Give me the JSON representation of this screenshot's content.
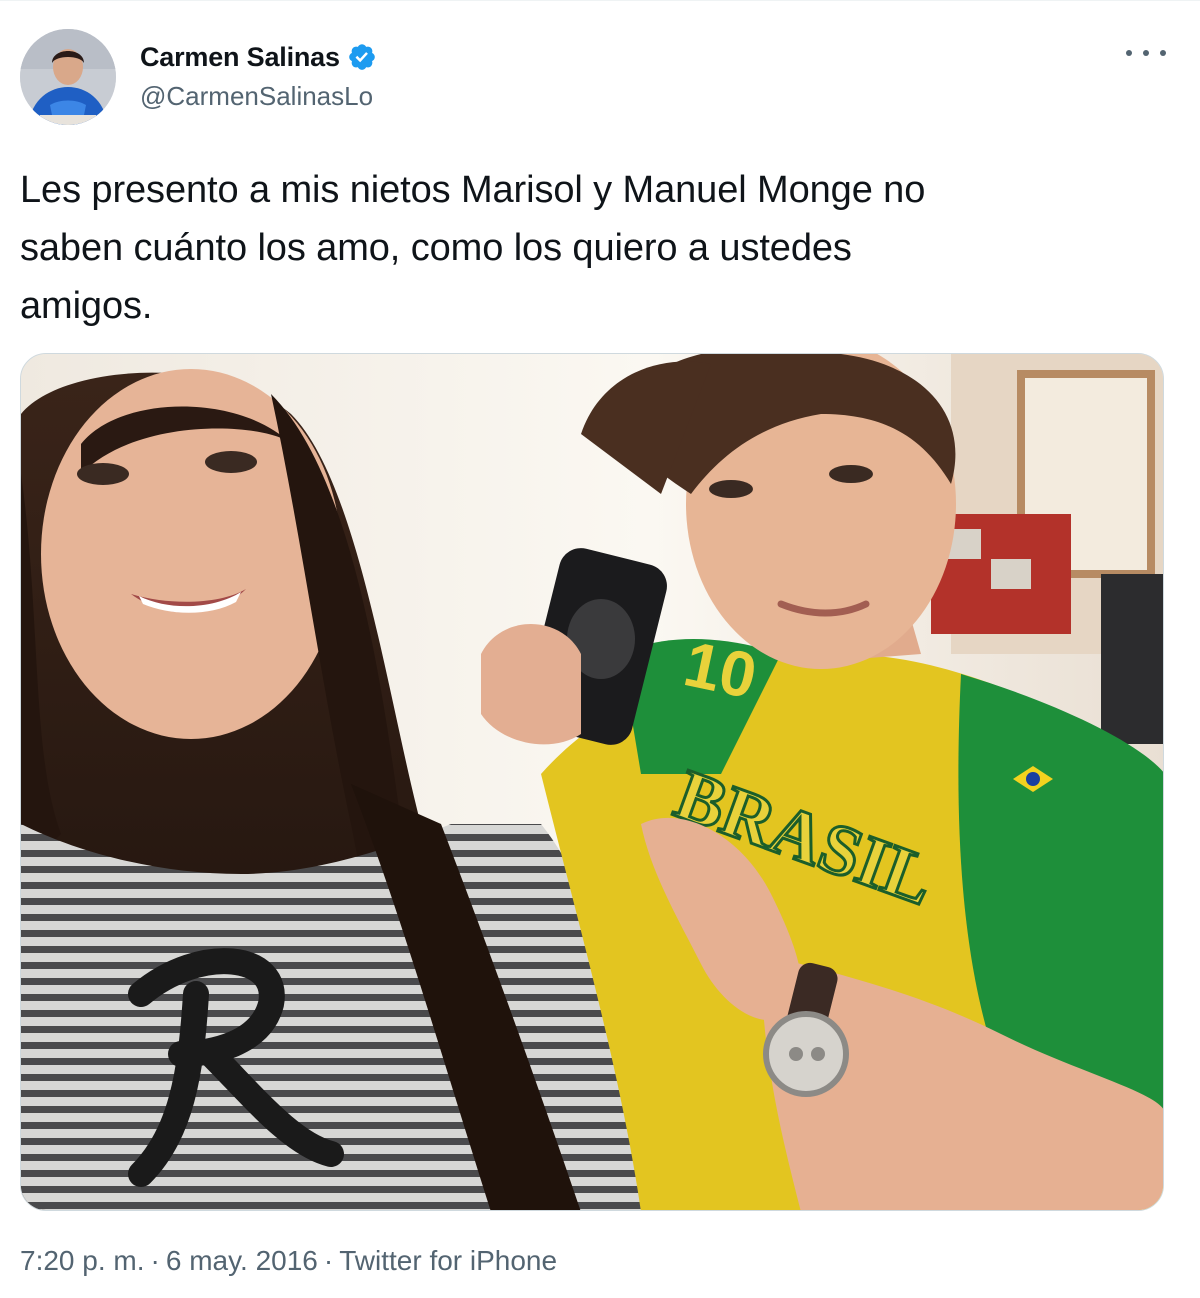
{
  "author": {
    "display_name": "Carmen Salinas",
    "handle": "@CarmenSalinasLo",
    "verified": true
  },
  "tweet": {
    "text_lines": [
      "Les presento a mis nietos Marisol y Manuel Monge no",
      "saben cuánto los amo, como los quiero a ustedes",
      "amigos."
    ]
  },
  "photo": {
    "shirt_text": "BRASIL",
    "shirt_number": "10"
  },
  "meta": {
    "time": "7:20 p. m.",
    "separator": "·",
    "date": "6 may. 2016",
    "source": "Twitter for iPhone"
  },
  "colors": {
    "text_primary": "#0f1419",
    "text_secondary": "#536471",
    "verified_blue": "#1d9bf0",
    "border": "#cfd9de"
  },
  "icons": {
    "verified": "verified-badge-icon",
    "more": "more-horizontal-icon"
  }
}
